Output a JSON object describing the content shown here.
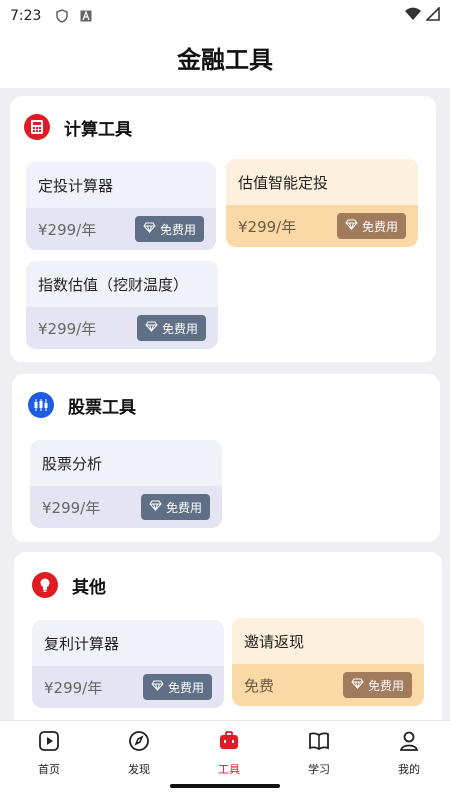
{
  "status_bar": {
    "time": "7:23"
  },
  "header": {
    "title": "金融工具"
  },
  "sections": [
    {
      "title": "计算工具",
      "icon": "calculator-icon",
      "cards": [
        {
          "name": "定投计算器",
          "price": "¥299/年",
          "badge": "免费用",
          "style": "normal"
        },
        {
          "name": "估值智能定投",
          "price": "¥299/年",
          "badge": "免费用",
          "style": "gold"
        },
        {
          "name": "指数估值（挖财温度）",
          "price": "¥299/年",
          "badge": "免费用",
          "style": "normal"
        }
      ]
    },
    {
      "title": "股票工具",
      "icon": "candlestick-chart-icon",
      "cards": [
        {
          "name": "股票分析",
          "price": "¥299/年",
          "badge": "免费用",
          "style": "normal"
        }
      ]
    },
    {
      "title": "其他",
      "icon": "lightbulb-icon",
      "cards": [
        {
          "name": "复利计算器",
          "price": "¥299/年",
          "badge": "免费用",
          "style": "normal"
        },
        {
          "name": "邀请返现",
          "price": "免费",
          "badge": "免费用",
          "style": "gold"
        }
      ]
    }
  ],
  "tabbar": {
    "items": [
      {
        "label": "首页",
        "icon": "play-square-icon",
        "active": false
      },
      {
        "label": "发现",
        "icon": "compass-icon",
        "active": false
      },
      {
        "label": "工具",
        "icon": "toolbox-icon",
        "active": true
      },
      {
        "label": "学习",
        "icon": "book-icon",
        "active": false
      },
      {
        "label": "我的",
        "icon": "person-icon",
        "active": false
      }
    ]
  },
  "colors": {
    "accent": "#e01b24",
    "blue": "#1e5de0",
    "gold_badge": "#a27a5c",
    "badge": "#5f6f86"
  }
}
